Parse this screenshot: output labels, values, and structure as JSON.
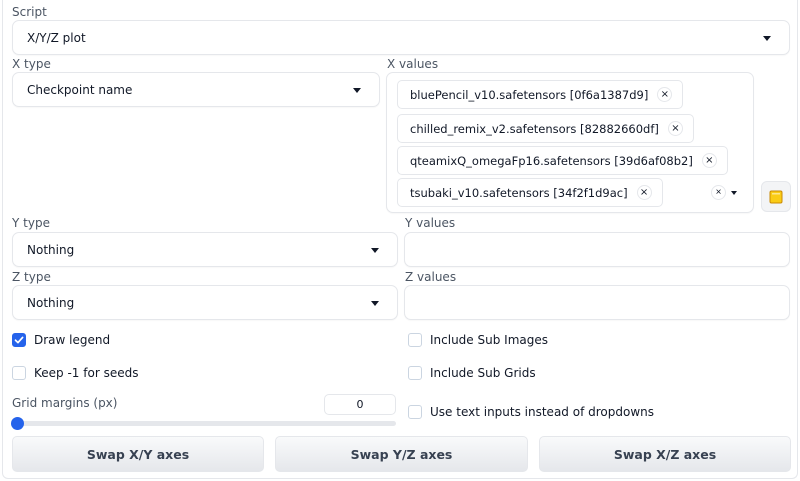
{
  "script": {
    "label": "Script",
    "value": "X/Y/Z plot"
  },
  "x_type": {
    "label": "X type",
    "value": "Checkpoint name"
  },
  "x_values": {
    "label": "X values",
    "tags": [
      "bluePencil_v10.safetensors [0f6a1387d9]",
      "chilled_remix_v2.safetensors [82882660df]",
      "qteamixQ_omegaFp16.safetensors [39d6af08b2]",
      "tsubaki_v10.safetensors [34f2f1d9ac]"
    ],
    "tag_remove_glyph": "×",
    "clear_glyph": "×"
  },
  "y_type": {
    "label": "Y type",
    "value": "Nothing"
  },
  "y_values": {
    "label": "Y values",
    "value": ""
  },
  "z_type": {
    "label": "Z type",
    "value": "Nothing"
  },
  "z_values": {
    "label": "Z values",
    "value": ""
  },
  "checkboxes": {
    "draw_legend": {
      "label": "Draw legend",
      "checked": true
    },
    "keep_seeds": {
      "label": "Keep -1 for seeds",
      "checked": false
    },
    "include_sub_images": {
      "label": "Include Sub Images",
      "checked": false
    },
    "include_sub_grids": {
      "label": "Include Sub Grids",
      "checked": false
    },
    "use_text_inputs": {
      "label": "Use text inputs instead of dropdowns",
      "checked": false
    }
  },
  "grid_margins": {
    "label": "Grid margins (px)",
    "value": "0"
  },
  "buttons": {
    "swap_xy": "Swap X/Y axes",
    "swap_yz": "Swap Y/Z axes",
    "swap_xz": "Swap X/Z axes"
  },
  "icons": {
    "fill_values": "folder-icon",
    "checkbox_checked": "checkmark-icon"
  },
  "colors": {
    "accent": "#2563eb",
    "folder": "#facc15"
  }
}
